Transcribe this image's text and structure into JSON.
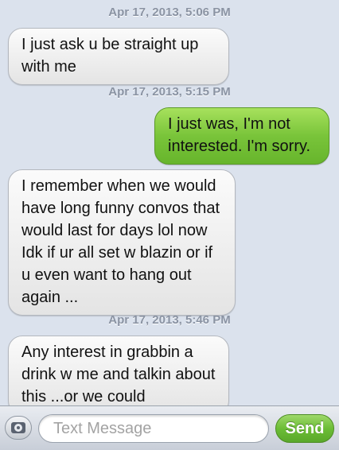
{
  "messages": [
    {
      "timestamp": "Apr 17, 2013, 5:06 PM"
    },
    {
      "direction": "in",
      "text": "I just ask u be straight up with me"
    },
    {
      "timestamp": "Apr 17, 2013, 5:15 PM"
    },
    {
      "direction": "out",
      "text": "I just was, I'm not interested. I'm sorry."
    },
    {
      "direction": "in",
      "text": "I remember when we would have long funny convos that would last for days lol now Idk if ur all set w blazin or if u even want to hang out again ..."
    },
    {
      "timestamp": "Apr 17, 2013, 5:46 PM"
    },
    {
      "direction": "in",
      "text": "Any interest in grabbin a drink w me and talkin about this ...or we could"
    }
  ],
  "input_bar": {
    "placeholder": "Text Message",
    "send_label": "Send",
    "camera_icon": "camera-icon"
  },
  "colors": {
    "background": "#dbe2ed",
    "incoming_bubble": "#eeeeee",
    "outgoing_bubble": "#79c43a",
    "send_button": "#6cbd36"
  }
}
